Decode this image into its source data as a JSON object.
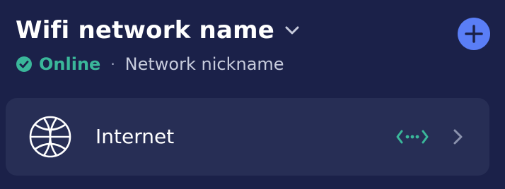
{
  "header": {
    "network_name": "Wifi network name"
  },
  "status": {
    "state": "Online",
    "separator": "·",
    "nickname": "Network nickname"
  },
  "internet_card": {
    "label": "Internet"
  },
  "icons": {
    "dropdown": "chevron-down-icon",
    "add": "plus-icon",
    "status": "check-circle-icon",
    "internet": "globe-icon",
    "connection": "connection-dots-icon",
    "navigate": "chevron-right-icon"
  },
  "colors": {
    "background": "#1b2149",
    "card": "#272e55",
    "accent_blue": "#5a7ef6",
    "online_green": "#3ab79a"
  }
}
